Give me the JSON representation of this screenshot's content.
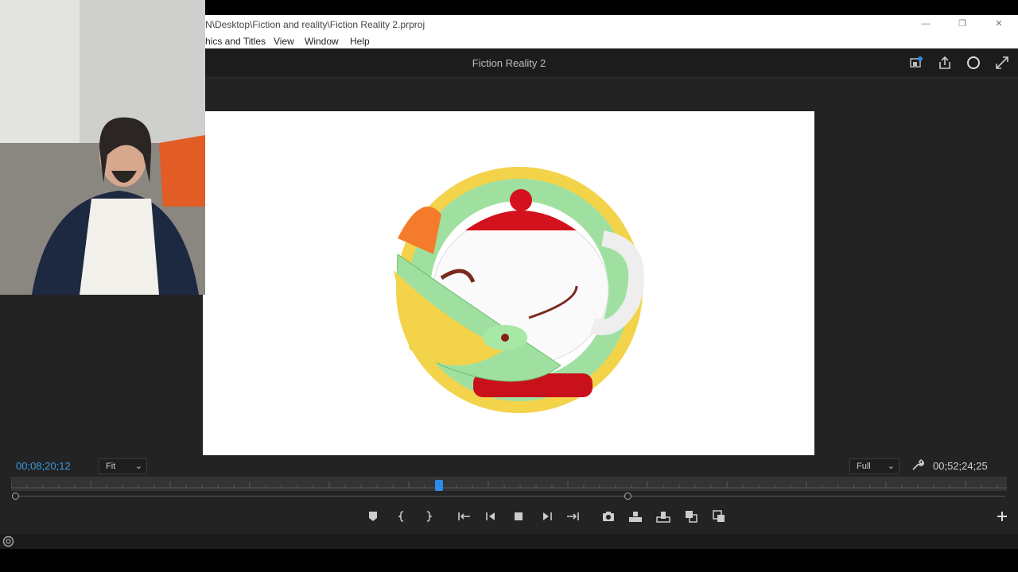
{
  "window": {
    "title_path": "N\\Desktop\\Fiction and reality\\Fiction Reality 2.prproj",
    "controls": [
      "—",
      "❐",
      "✕"
    ]
  },
  "menu": [
    "hics and Titles",
    "View",
    "Window",
    "Help"
  ],
  "header": {
    "sequence_title": "Fiction Reality 2",
    "icons": [
      "quick-export-icon",
      "share-icon",
      "circle-icon",
      "expand-icon"
    ]
  },
  "monitor": {
    "current_timecode": "00;08;20;12",
    "fit_label": "Fit",
    "resolution_label": "Full",
    "duration_timecode": "00;52;24;25",
    "playhead_fraction": 0.43
  },
  "colors": {
    "timecode_blue": "#3a9bdc",
    "playhead_blue": "#2d8ceb",
    "panel_bg": "#232323"
  },
  "transport": [
    "add-marker-icon",
    "mark-in-icon",
    "mark-out-icon",
    "go-to-in-icon",
    "step-back-icon",
    "stop-icon",
    "step-forward-icon",
    "go-to-out-icon",
    "export-frame-icon",
    "insert-icon",
    "overwrite-icon",
    "comparison-view-icon",
    "proxy-toggle-icon"
  ]
}
